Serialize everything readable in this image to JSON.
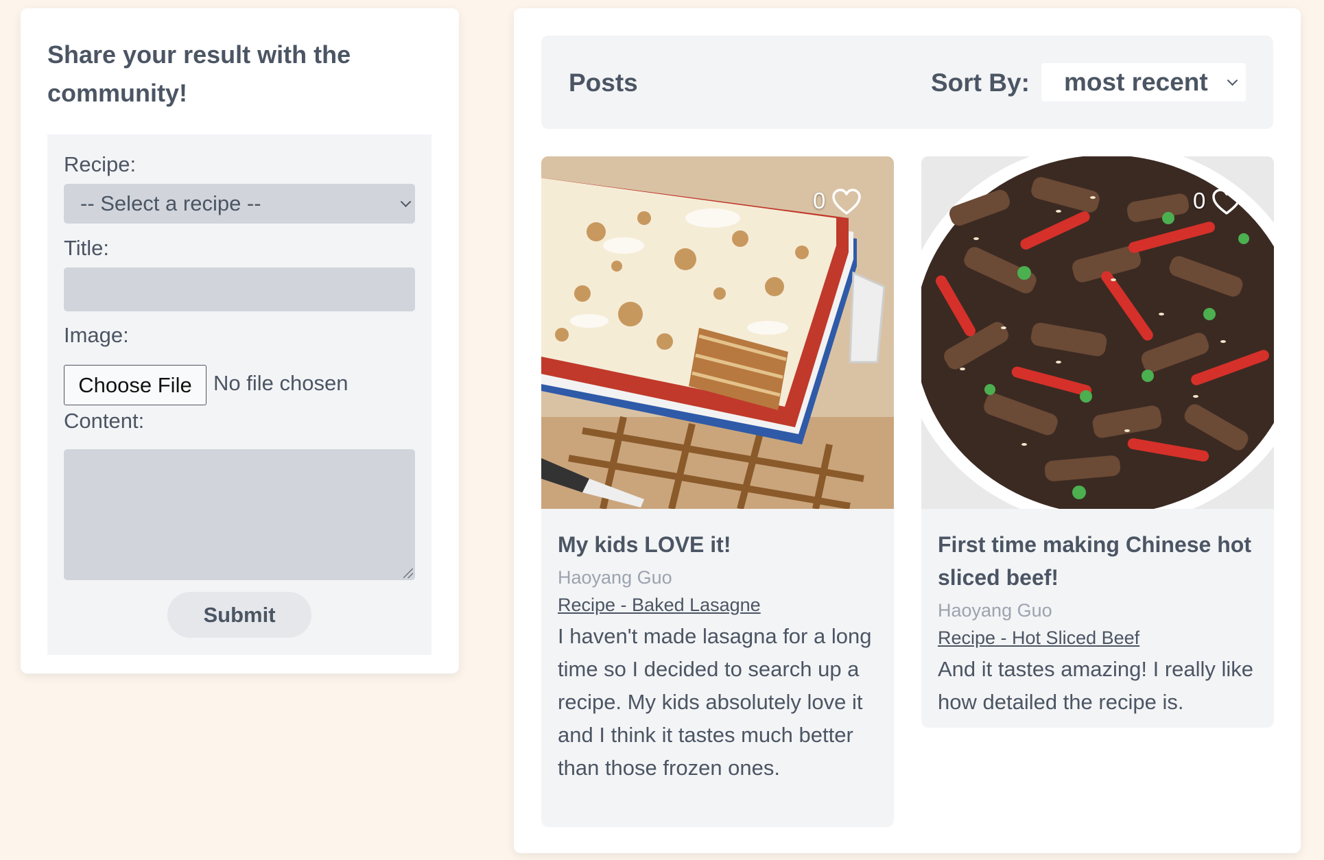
{
  "share": {
    "heading": "Share your result with the community!",
    "recipe_label": "Recipe:",
    "recipe_select_value": "-- Select a recipe --",
    "title_label": "Title:",
    "title_value": "",
    "image_label": "Image:",
    "choose_file_label": "Choose File",
    "file_status": "No file chosen",
    "content_label": "Content:",
    "content_value": "",
    "submit_label": "Submit"
  },
  "posts": {
    "heading": "Posts",
    "sort_label": "Sort By:",
    "sort_value": "most recent",
    "items": [
      {
        "title": "My kids LOVE it!",
        "author": "Haoyang Guo",
        "recipe_link": "Recipe - Baked Lasagne",
        "content": "I haven't made lasagna for a long time so I decided to search up a recipe. My kids absolutely love it and I think it tastes much better than those frozen ones.",
        "likes": "0",
        "image_subject": "baked lasagne in blue baking dish"
      },
      {
        "title": "First time making Chinese hot sliced beef!",
        "author": "Haoyang Guo",
        "recipe_link": "Recipe - Hot Sliced Beef",
        "content": "And it tastes amazing! I really like how detailed the recipe is.",
        "likes": "0",
        "image_subject": "hot sliced beef with red peppers and sesame"
      }
    ]
  },
  "colors": {
    "page_background": "#fdf5ec",
    "panel_background": "#ffffff",
    "form_background": "#f3f4f6",
    "input_background": "#d1d5db",
    "text": "#4b5563",
    "muted_text": "#9ca3af"
  },
  "icons": {
    "like": "heart-icon",
    "select": "chevron-down-icon"
  }
}
